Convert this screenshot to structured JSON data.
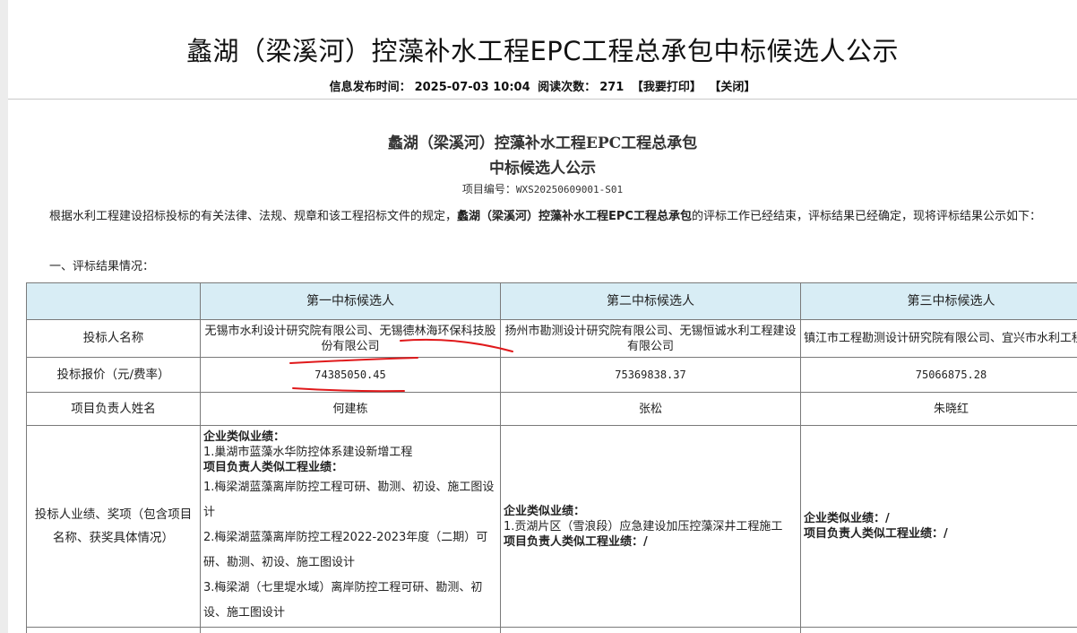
{
  "header": {
    "title": "蠡湖（梁溪河）控藻补水工程EPC工程总承包中标候选人公示",
    "publish_label": "信息发布时间：",
    "publish_time": "2025-07-03 10:04",
    "reads_label": "阅读次数：",
    "reads_count": "271",
    "print_label": "【我要打印】",
    "close_label": "【关闭】"
  },
  "doc": {
    "heading_line1": "蠡湖（梁溪河）控藻补水工程EPC工程总承包",
    "heading_line2": "中标候选人公示",
    "project_no_label": "项目编号：",
    "project_no": "WXS20250609001-S01",
    "intro_pre": "根据水利工程建设招标投标的有关法律、法规、规章和该工程招标文件的规定，",
    "intro_bold": "蠡湖（梁溪河）控藻补水工程EPC工程总承包",
    "intro_post": "的评标工作已经结束，评标结果已经确定，现将评标结果公示如下：",
    "section1": "一、评标结果情况："
  },
  "table": {
    "headers": [
      "",
      "第一中标候选人",
      "第二中标候选人",
      "第三中标候选人"
    ],
    "rows": {
      "bidder": {
        "label": "投标人名称",
        "c1": "无锡市水利设计研究院有限公司、无锡德林海环保科技股份有限公司",
        "c2": "扬州市勘测设计研究院有限公司、无锡恒诚水利工程建设有限公司",
        "c3": "镇江市工程勘测设计研究院有限公司、宜兴市水利工程有限公司"
      },
      "price": {
        "label": "投标报价（元/费率）",
        "c1": "74385050.45",
        "c2": "75369838.37",
        "c3": "75066875.28"
      },
      "manager": {
        "label": "项目负责人姓名",
        "c1": "何建栋",
        "c2": "张松",
        "c3": "朱晓红"
      },
      "performance": {
        "label": "投标人业绩、奖项（包含项目名称、获奖具体情况）",
        "c1_company_label": "企业类似业绩：",
        "c1_company_item1": "1.巢湖市蓝藻水华防控体系建设新增工程",
        "c1_manager_label": "项目负责人类似工程业绩：",
        "c1_manager_item1": "1.梅梁湖蓝藻离岸防控工程可研、勘测、初设、施工图设计",
        "c1_manager_item2": "2.梅梁湖蓝藻离岸防控工程2022-2023年度（二期）可研、勘测、初设、施工图设计",
        "c1_manager_item3": "3.梅梁湖（七里堤水域）离岸防控工程可研、勘测、初设、施工图设计",
        "c2_company_label": "企业类似业绩：",
        "c2_company_item1": "1.贡湖片区（雪浪段）应急建设加压控藻深井工程施工",
        "c2_manager_label": "项目负责人类似工程业绩：/",
        "c3_company_label": "企业类似业绩：/",
        "c3_manager_label": "项目负责人类似工程业绩：/"
      }
    },
    "annotation_color": "#e0191b"
  }
}
